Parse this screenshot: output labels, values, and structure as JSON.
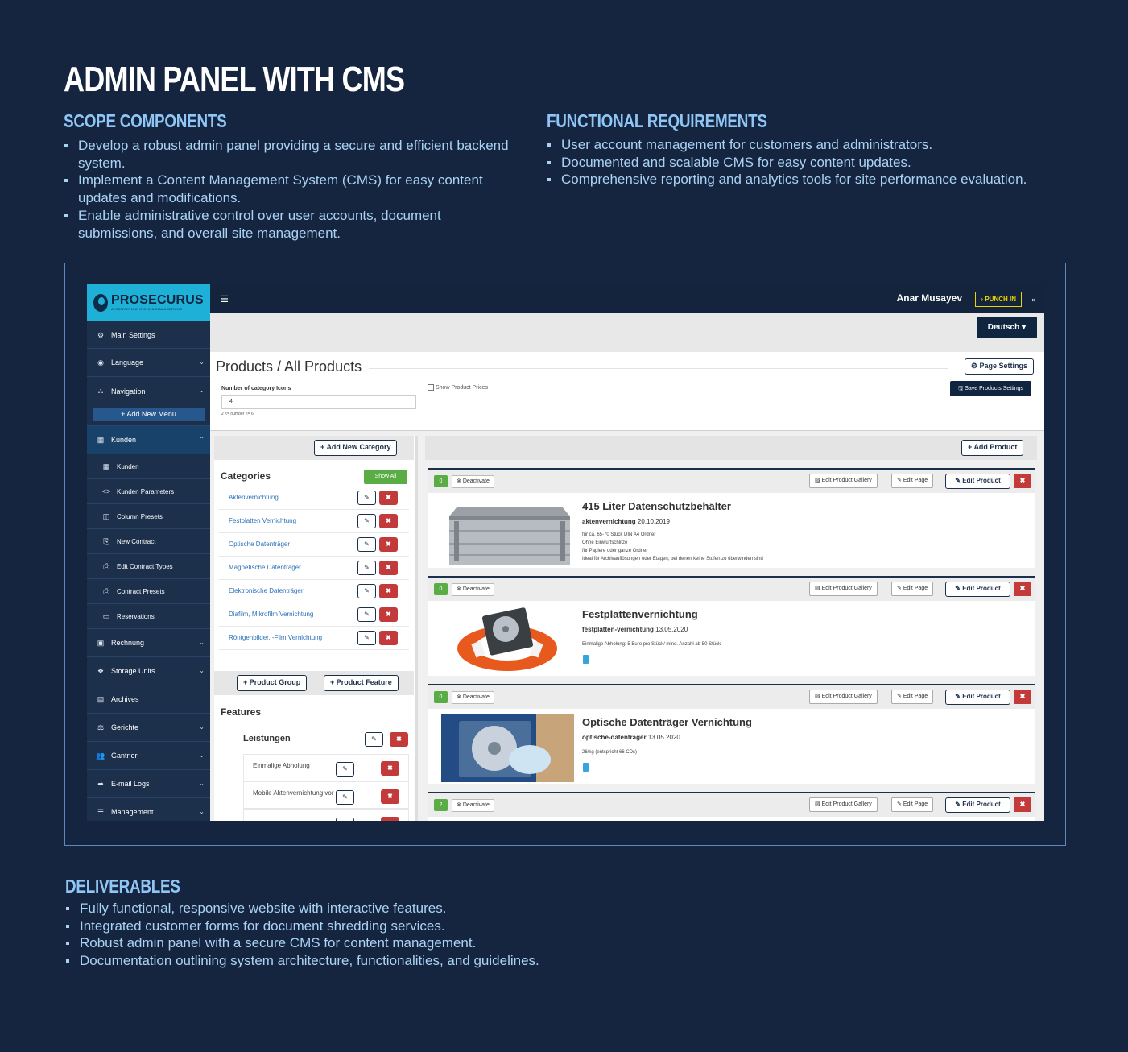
{
  "headline": "ADMIN PANEL WITH CMS",
  "scope": {
    "title": "SCOPE COMPONENTS",
    "items": [
      "Develop a robust admin panel providing a secure and efficient backend system.",
      "Implement a Content Management System (CMS) for easy content updates and modifications.",
      "Enable administrative control over user accounts, document submissions, and overall site management."
    ]
  },
  "functional": {
    "title": "FUNCTIONAL REQUIREMENTS",
    "items": [
      "User account management for customers and administrators.",
      "Documented and scalable CMS for easy content updates.",
      "Comprehensive reporting and analytics tools for site performance evaluation."
    ]
  },
  "deliverables": {
    "title": "DELIVERABLES",
    "items": [
      "Fully functional, responsive website with interactive features.",
      "Integrated customer forms for document shredding services.",
      "Robust admin panel with a secure CMS for content management.",
      "Documentation outlining system architecture, functionalities, and guidelines."
    ]
  },
  "app": {
    "logo": {
      "name": "PROSECURUS",
      "tagline": "AKTENVERNICHTUNG & EINLAGERUNG"
    },
    "topbar": {
      "user": "Anar Musayev",
      "punch": "PUNCH IN",
      "language": "Deutsch"
    },
    "sidebar": {
      "main_settings": "Main Settings",
      "language": "Language",
      "navigation": "Navigation",
      "add_new_menu": "Add New Menu",
      "kunden": "Kunden",
      "kunden_sub": [
        "Kunden",
        "Kunden Parameters",
        "Column Presets",
        "New Contract",
        "Edit Contract Types",
        "Contract Presets",
        "Reservations"
      ],
      "rechnung": "Rechnung",
      "storage_units": "Storage Units",
      "archives": "Archives",
      "gerichte": "Gerichte",
      "gantner": "Gantner",
      "email_logs": "E-mail Logs",
      "management": "Management"
    },
    "page": {
      "title": "Products / All Products",
      "page_settings": "Page Settings",
      "num_icons_label": "Number of category Icons",
      "num_icons_value": "4",
      "num_icons_help": "2 <= number <= 6",
      "show_prices": "Show Product Prices",
      "save_settings": "Save Products Settings"
    },
    "categories": {
      "add_button": "Add New Category",
      "title": "Categories",
      "show_all": "Show All",
      "items": [
        "Aktenvernichtung",
        "Festplatten Vernichtung",
        "Optische Datenträger",
        "Magnetische Datenträger",
        "Elektronische Datenträger",
        "Diafilm, Mikrofilm Vernichtung",
        "Röntgenbilder, -Film Vernichtung"
      ]
    },
    "features": {
      "product_group": "Product Group",
      "product_feature": "Product Feature",
      "title": "Features",
      "group": "Leistungen",
      "items": [
        "Einmalige Abholung",
        "Mobile Aktenvernichtung vor Ort"
      ]
    },
    "products": {
      "add_button": "Add Product",
      "deactivate": "Deactivate",
      "edit_gallery": "Edit Product Gallery",
      "edit_page": "Edit Page",
      "edit_product": "Edit Product",
      "items": [
        {
          "count": "0",
          "title": "415 Liter Datenschutzbehälter",
          "slug": "aktenvernichtung",
          "date": "20.10.2019",
          "desc": [
            "für ca. 65-70 Stück DIN A4 Ordner",
            "Ohne Einwurfschlitze",
            "für Papiere oder ganze Ordner",
            "Ideal für Archivauflösungen oder Etagen, bei denen keine Stufen zu überwinden sind"
          ]
        },
        {
          "count": "0",
          "title": "Festplattenvernichtung",
          "slug": "festplatten-vernichtung",
          "date": "13.05.2020",
          "desc": [
            "Einmalige Abholung: 5 Euro pro Stück/ mind. Anzahl ab 50 Stück"
          ]
        },
        {
          "count": "0",
          "title": "Optische Datenträger Vernichtung",
          "slug": "optische-datentrager",
          "date": "13.05.2020",
          "desc": [
            "26/kg (entspricht 66 CDs)"
          ]
        },
        {
          "count": "2"
        }
      ]
    }
  }
}
